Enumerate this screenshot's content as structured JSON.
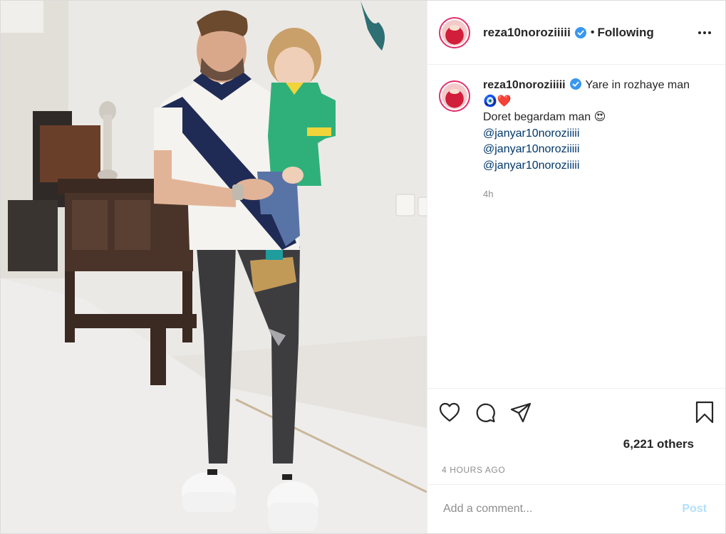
{
  "header": {
    "username": "reza10noroziiiii",
    "separator": "•",
    "follow_status": "Following",
    "more_icon": "more-horizontal-icon"
  },
  "caption": {
    "username": "reza10noroziiiii",
    "line1": "Yare in rozhaye man",
    "emoji_line": "🧿❤️",
    "line2": "Doret begardam man",
    "line2_emoji": "😍",
    "mentions": [
      "@janyar10noroziiiii",
      "@janyar10noroziiiii",
      "@janyar10noroziiiii"
    ],
    "relative_time": "4h"
  },
  "actions": {
    "like_icon": "heart-icon",
    "comment_icon": "comment-icon",
    "share_icon": "share-icon",
    "save_icon": "bookmark-icon"
  },
  "likes_text": "6,221 others",
  "posted_time": "4 HOURS AGO",
  "comment_box": {
    "placeholder": "Add a comment...",
    "post_label": "Post"
  },
  "colors": {
    "text": "#262626",
    "muted": "#8e8e8e",
    "link": "#00376b",
    "verified": "#3897f0",
    "post_disabled": "#b2dffc"
  }
}
